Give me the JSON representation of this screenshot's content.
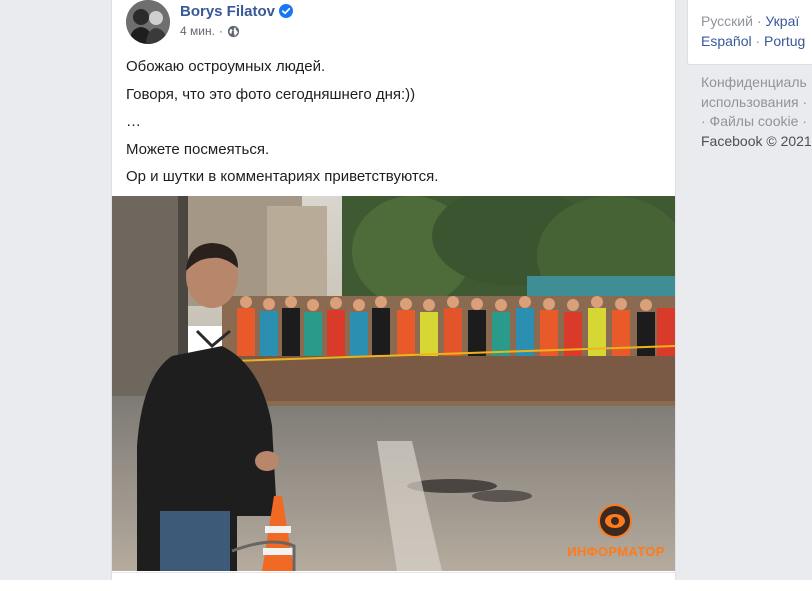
{
  "post": {
    "author": "Borys Filatov",
    "time": "4 мин.",
    "time_separator": "·",
    "verified_icon": "verified-badge-icon",
    "privacy_icon": "globe-icon",
    "text_lines": [
      "Обожаю остроумных людей.",
      "Говоря, что это фото сегодняшнего дня:))",
      "…",
      "Можете посмеяться.",
      "Ор и шутки в комментариях приветствуются."
    ],
    "photo": {
      "watermark": "ИНФОРМАТОР",
      "logo_icon": "informator-eye-logo"
    }
  },
  "sidebar": {
    "languages": {
      "current": "Русский",
      "links": [
        "Украї",
        "Español",
        "Portug"
      ],
      "separator": "·"
    },
    "footer": {
      "line1": "Конфиденциаль",
      "line2": "использования ·",
      "line3": "· Файлы cookie ·",
      "copyright": "Facebook © 2021"
    }
  },
  "colors": {
    "link_blue": "#385898",
    "verified_blue": "#1877f2",
    "muted_gray": "#90949c",
    "page_bg": "#e9ebee",
    "watermark_orange": "#ff7a1a"
  }
}
